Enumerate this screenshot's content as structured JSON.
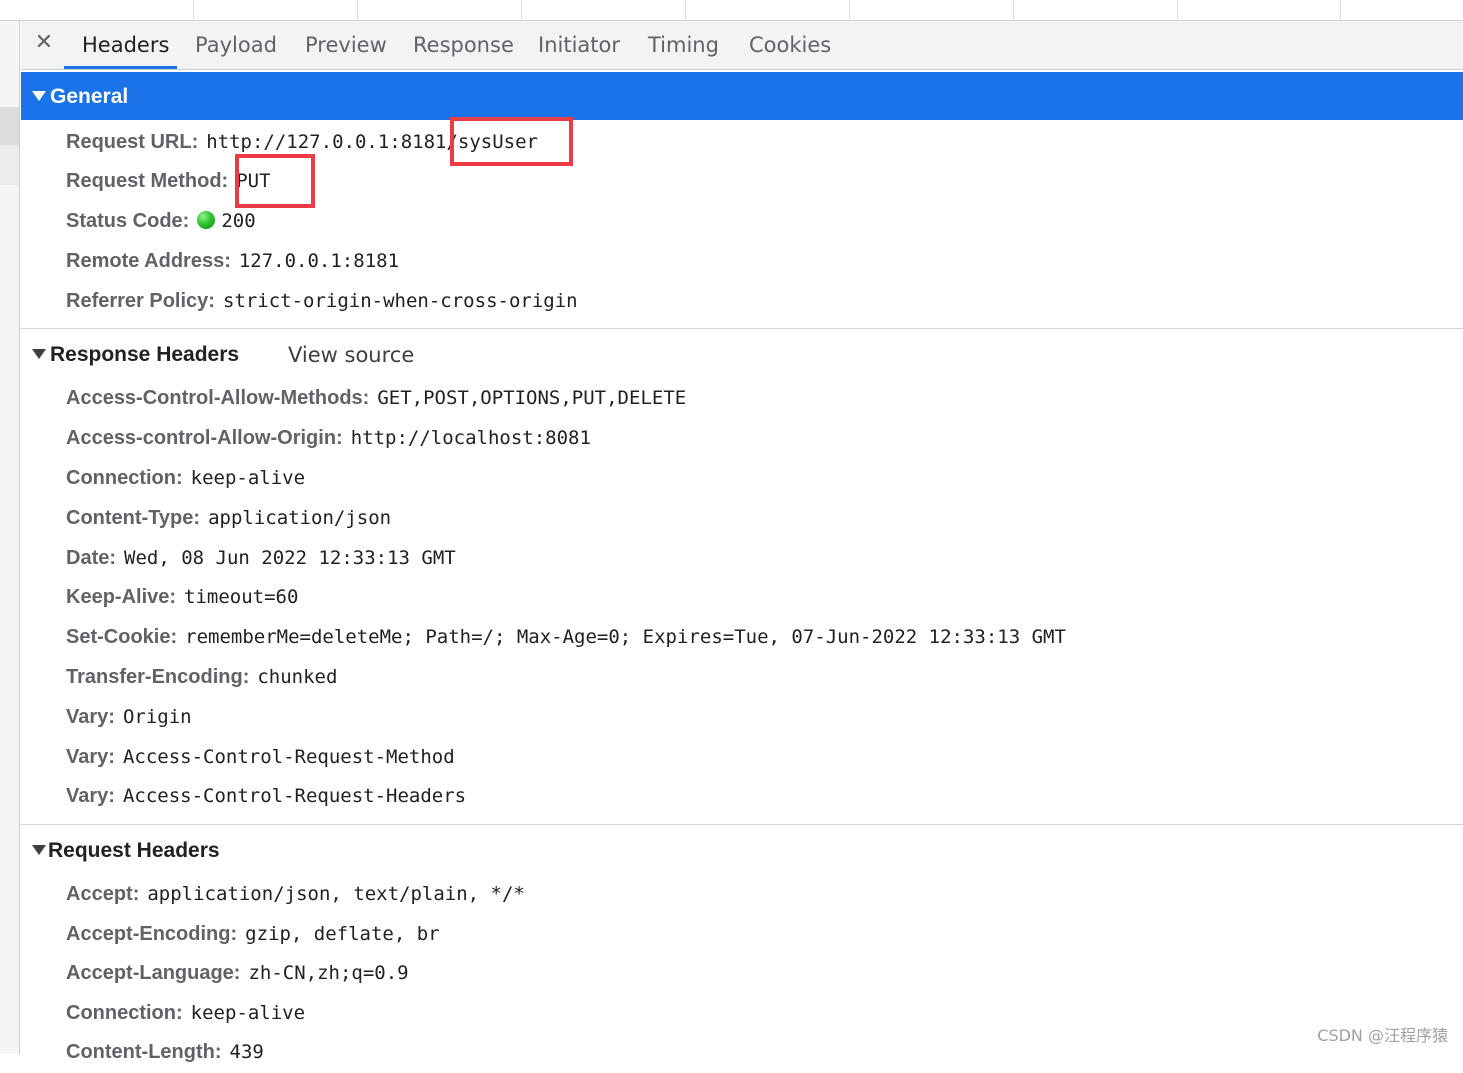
{
  "tabs": [
    {
      "label": "Headers",
      "active": true
    },
    {
      "label": "Payload"
    },
    {
      "label": "Preview"
    },
    {
      "label": "Response"
    },
    {
      "label": "Initiator"
    },
    {
      "label": "Timing"
    },
    {
      "label": "Cookies"
    }
  ],
  "close_glyph": "✕",
  "general": {
    "title": "General",
    "rows": [
      {
        "name": "Request URL:",
        "value": "http://127.0.0.1:8181/sysUser"
      },
      {
        "name": "Request Method:",
        "value": "PUT"
      },
      {
        "name": "Status Code:",
        "value": "200",
        "status_color": "#2ec42e"
      },
      {
        "name": "Remote Address:",
        "value": "127.0.0.1:8181"
      },
      {
        "name": "Referrer Policy:",
        "value": "strict-origin-when-cross-origin"
      }
    ]
  },
  "response_headers": {
    "title": "Response Headers",
    "view_source": "View source",
    "rows": [
      {
        "name": "Access-Control-Allow-Methods:",
        "value": "GET,POST,OPTIONS,PUT,DELETE"
      },
      {
        "name": "Access-control-Allow-Origin:",
        "value": "http://localhost:8081"
      },
      {
        "name": "Connection:",
        "value": "keep-alive"
      },
      {
        "name": "Content-Type:",
        "value": "application/json"
      },
      {
        "name": "Date:",
        "value": "Wed, 08 Jun 2022 12:33:13 GMT"
      },
      {
        "name": "Keep-Alive:",
        "value": "timeout=60"
      },
      {
        "name": "Set-Cookie:",
        "value": "rememberMe=deleteMe; Path=/; Max-Age=0; Expires=Tue, 07-Jun-2022 12:33:13 GMT"
      },
      {
        "name": "Transfer-Encoding:",
        "value": "chunked"
      },
      {
        "name": "Vary:",
        "value": "Origin"
      },
      {
        "name": "Vary:",
        "value": "Access-Control-Request-Method"
      },
      {
        "name": "Vary:",
        "value": "Access-Control-Request-Headers"
      }
    ]
  },
  "request_headers": {
    "title": "Request Headers",
    "rows": [
      {
        "name": "Accept:",
        "value": "application/json, text/plain, */*"
      },
      {
        "name": "Accept-Encoding:",
        "value": "gzip, deflate, br"
      },
      {
        "name": "Accept-Language:",
        "value": "zh-CN,zh;q=0.9"
      },
      {
        "name": "Connection:",
        "value": "keep-alive"
      },
      {
        "name": "Content-Length:",
        "value": "439"
      }
    ]
  },
  "watermark": "CSDN @汪程序猿",
  "colors": {
    "accent": "#1a73e8",
    "highlight": "#ea3b46",
    "header_name": "#5f6368"
  }
}
